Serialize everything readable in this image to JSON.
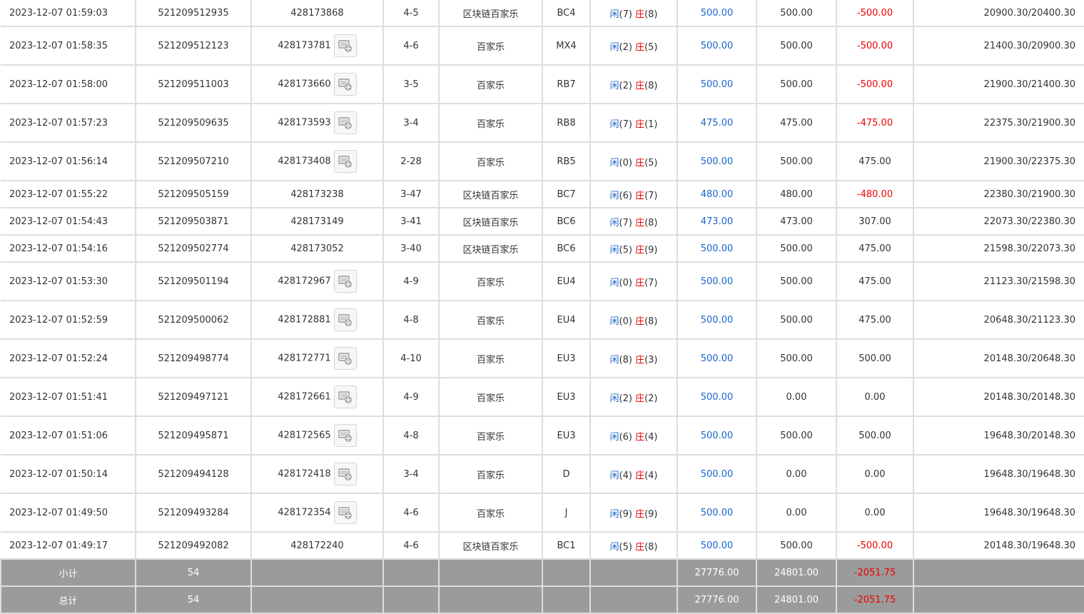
{
  "rows": [
    {
      "time": "2023-12-07 01:59:03",
      "order_no": "521209512935",
      "game_no": "428173868",
      "video": false,
      "round": "4-5",
      "game": "区块链百家乐",
      "table": "BC4",
      "result": {
        "player_label": "闲",
        "player_score": "(7)",
        "banker_label": "庄",
        "banker_score": "(8)"
      },
      "bet": "500.00",
      "valid": "500.00",
      "winloss": "-500.00",
      "balance": "20900.30/20400.30"
    },
    {
      "time": "2023-12-07 01:58:35",
      "order_no": "521209512123",
      "game_no": "428173781",
      "video": true,
      "round": "4-6",
      "game": "百家乐",
      "table": "MX4",
      "result": {
        "player_label": "闲",
        "player_score": "(2)",
        "banker_label": "庄",
        "banker_score": "(5)"
      },
      "bet": "500.00",
      "valid": "500.00",
      "winloss": "-500.00",
      "balance": "21400.30/20900.30"
    },
    {
      "time": "2023-12-07 01:58:00",
      "order_no": "521209511003",
      "game_no": "428173660",
      "video": true,
      "round": "3-5",
      "game": "百家乐",
      "table": "RB7",
      "result": {
        "player_label": "闲",
        "player_score": "(2)",
        "banker_label": "庄",
        "banker_score": "(8)"
      },
      "bet": "500.00",
      "valid": "500.00",
      "winloss": "-500.00",
      "balance": "21900.30/21400.30"
    },
    {
      "time": "2023-12-07 01:57:23",
      "order_no": "521209509635",
      "game_no": "428173593",
      "video": true,
      "round": "3-4",
      "game": "百家乐",
      "table": "RB8",
      "result": {
        "player_label": "闲",
        "player_score": "(7)",
        "banker_label": "庄",
        "banker_score": "(1)"
      },
      "bet": "475.00",
      "valid": "475.00",
      "winloss": "-475.00",
      "balance": "22375.30/21900.30"
    },
    {
      "time": "2023-12-07 01:56:14",
      "order_no": "521209507210",
      "game_no": "428173408",
      "video": true,
      "round": "2-28",
      "game": "百家乐",
      "table": "RB5",
      "result": {
        "player_label": "闲",
        "player_score": "(0)",
        "banker_label": "庄",
        "banker_score": "(5)"
      },
      "bet": "500.00",
      "valid": "500.00",
      "winloss": "475.00",
      "balance": "21900.30/22375.30"
    },
    {
      "time": "2023-12-07 01:55:22",
      "order_no": "521209505159",
      "game_no": "428173238",
      "video": false,
      "round": "3-47",
      "game": "区块链百家乐",
      "table": "BC7",
      "result": {
        "player_label": "闲",
        "player_score": "(6)",
        "banker_label": "庄",
        "banker_score": "(7)"
      },
      "bet": "480.00",
      "valid": "480.00",
      "winloss": "-480.00",
      "balance": "22380.30/21900.30"
    },
    {
      "time": "2023-12-07 01:54:43",
      "order_no": "521209503871",
      "game_no": "428173149",
      "video": false,
      "round": "3-41",
      "game": "区块链百家乐",
      "table": "BC6",
      "result": {
        "player_label": "闲",
        "player_score": "(7)",
        "banker_label": "庄",
        "banker_score": "(8)"
      },
      "bet": "473.00",
      "valid": "473.00",
      "winloss": "307.00",
      "balance": "22073.30/22380.30"
    },
    {
      "time": "2023-12-07 01:54:16",
      "order_no": "521209502774",
      "game_no": "428173052",
      "video": false,
      "round": "3-40",
      "game": "区块链百家乐",
      "table": "BC6",
      "result": {
        "player_label": "闲",
        "player_score": "(5)",
        "banker_label": "庄",
        "banker_score": "(9)"
      },
      "bet": "500.00",
      "valid": "500.00",
      "winloss": "475.00",
      "balance": "21598.30/22073.30"
    },
    {
      "time": "2023-12-07 01:53:30",
      "order_no": "521209501194",
      "game_no": "428172967",
      "video": true,
      "round": "4-9",
      "game": "百家乐",
      "table": "EU4",
      "result": {
        "player_label": "闲",
        "player_score": "(0)",
        "banker_label": "庄",
        "banker_score": "(7)"
      },
      "bet": "500.00",
      "valid": "500.00",
      "winloss": "475.00",
      "balance": "21123.30/21598.30"
    },
    {
      "time": "2023-12-07 01:52:59",
      "order_no": "521209500062",
      "game_no": "428172881",
      "video": true,
      "round": "4-8",
      "game": "百家乐",
      "table": "EU4",
      "result": {
        "player_label": "闲",
        "player_score": "(0)",
        "banker_label": "庄",
        "banker_score": "(8)"
      },
      "bet": "500.00",
      "valid": "500.00",
      "winloss": "475.00",
      "balance": "20648.30/21123.30"
    },
    {
      "time": "2023-12-07 01:52:24",
      "order_no": "521209498774",
      "game_no": "428172771",
      "video": true,
      "round": "4-10",
      "game": "百家乐",
      "table": "EU3",
      "result": {
        "player_label": "闲",
        "player_score": "(8)",
        "banker_label": "庄",
        "banker_score": "(3)"
      },
      "bet": "500.00",
      "valid": "500.00",
      "winloss": "500.00",
      "balance": "20148.30/20648.30"
    },
    {
      "time": "2023-12-07 01:51:41",
      "order_no": "521209497121",
      "game_no": "428172661",
      "video": true,
      "round": "4-9",
      "game": "百家乐",
      "table": "EU3",
      "result": {
        "player_label": "闲",
        "player_score": "(2)",
        "banker_label": "庄",
        "banker_score": "(2)"
      },
      "bet": "500.00",
      "valid": "0.00",
      "winloss": "0.00",
      "balance": "20148.30/20148.30"
    },
    {
      "time": "2023-12-07 01:51:06",
      "order_no": "521209495871",
      "game_no": "428172565",
      "video": true,
      "round": "4-8",
      "game": "百家乐",
      "table": "EU3",
      "result": {
        "player_label": "闲",
        "player_score": "(6)",
        "banker_label": "庄",
        "banker_score": "(4)"
      },
      "bet": "500.00",
      "valid": "500.00",
      "winloss": "500.00",
      "balance": "19648.30/20148.30"
    },
    {
      "time": "2023-12-07 01:50:14",
      "order_no": "521209494128",
      "game_no": "428172418",
      "video": true,
      "round": "3-4",
      "game": "百家乐",
      "table": "D",
      "result": {
        "player_label": "闲",
        "player_score": "(4)",
        "banker_label": "庄",
        "banker_score": "(4)"
      },
      "bet": "500.00",
      "valid": "0.00",
      "winloss": "0.00",
      "balance": "19648.30/19648.30"
    },
    {
      "time": "2023-12-07 01:49:50",
      "order_no": "521209493284",
      "game_no": "428172354",
      "video": true,
      "round": "4-6",
      "game": "百家乐",
      "table": "J",
      "result": {
        "player_label": "闲",
        "player_score": "(9)",
        "banker_label": "庄",
        "banker_score": "(9)"
      },
      "bet": "500.00",
      "valid": "0.00",
      "winloss": "0.00",
      "balance": "19648.30/19648.30"
    },
    {
      "time": "2023-12-07 01:49:17",
      "order_no": "521209492082",
      "game_no": "428172240",
      "video": false,
      "round": "4-6",
      "game": "区块链百家乐",
      "table": "BC1",
      "result": {
        "player_label": "闲",
        "player_score": "(5)",
        "banker_label": "庄",
        "banker_score": "(8)"
      },
      "bet": "500.00",
      "valid": "500.00",
      "winloss": "-500.00",
      "balance": "20148.30/19648.30"
    }
  ],
  "subtotal": {
    "label": "小计",
    "count": "54",
    "bet": "27776.00",
    "valid": "24801.00",
    "winloss": "-2051.75"
  },
  "total": {
    "label": "总计",
    "count": "54",
    "bet": "27776.00",
    "valid": "24801.00",
    "winloss": "-2051.75"
  },
  "icons": {
    "video_replay": "video-replay-icon"
  },
  "colors": {
    "link_blue": "#1a66cc",
    "loss_red": "#ee0000",
    "footer_gray": "#9b9b9b",
    "border": "#dddddd"
  }
}
